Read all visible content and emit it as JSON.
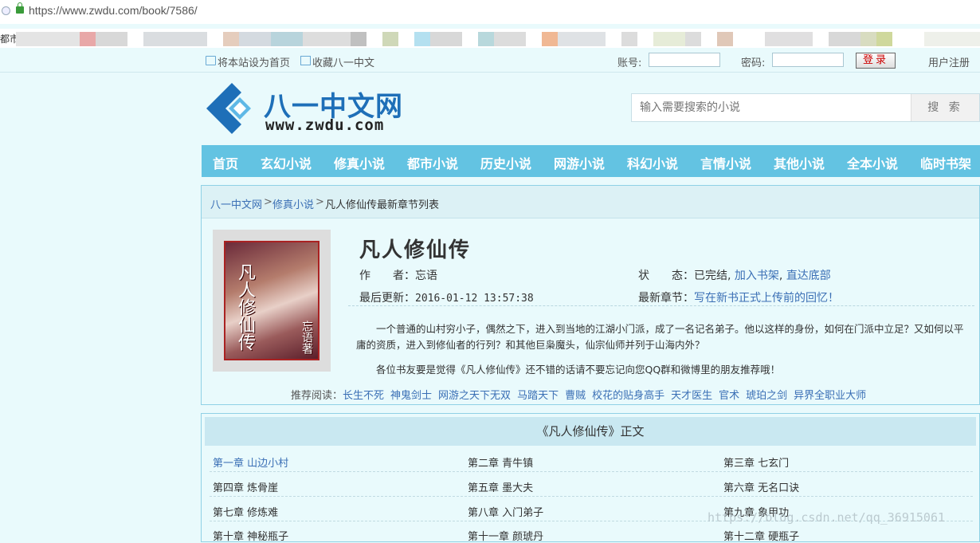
{
  "browser": {
    "url": "https://www.zwdu.com/book/7586/",
    "bookmark_label": "都市"
  },
  "topbar": {
    "set_home": "将本站设为首页",
    "favorite": "收藏八一中文",
    "account_label": "账号:",
    "password_label": "密码:",
    "login": "登录",
    "register": "用户注册"
  },
  "header": {
    "logo_cn": "八一中文网",
    "logo_url": "www.zwdu.com",
    "search_placeholder": "输入需要搜索的小说",
    "search_button": "搜 索"
  },
  "nav": [
    "首页",
    "玄幻小说",
    "修真小说",
    "都市小说",
    "历史小说",
    "网游小说",
    "科幻小说",
    "言情小说",
    "其他小说",
    "全本小说",
    "临时书架"
  ],
  "breadcrumb": {
    "home": "八一中文网",
    "category": "修真小说",
    "current": "凡人修仙传最新章节列表"
  },
  "book": {
    "title": "凡人修仙传",
    "cover_text": "凡人修仙传",
    "cover_author": "忘语著",
    "author_label": "作　　者：",
    "author": "忘语",
    "status_label": "状　　态：",
    "status": "已完结,",
    "add_shelf": "加入书架",
    "bottom": "直达底部",
    "updated_label": "最后更新：",
    "updated": "2016-01-12 13:57:38",
    "latest_label": "最新章节：",
    "latest": "写在新书正式上传前的回忆！",
    "description": "一个普通的山村穷小子，偶然之下，进入到当地的江湖小门派，成了一名记名弟子。他以这样的身份，如何在门派中立足？又如何以平庸的资质，进入到修仙者的行列？和其他巨枭魔头，仙宗仙师并列于山海内外？",
    "recommend_msg": "各位书友要是觉得《凡人修仙传》还不错的话请不要忘记向您QQ群和微博里的朋友推荐哦！"
  },
  "recommend": {
    "label": "推荐阅读：",
    "items": [
      "长生不死",
      "神鬼剑士",
      "网游之天下无双",
      "马踏天下",
      "曹贼",
      "校花的贴身高手",
      "天才医生",
      "官术",
      "琥珀之剑",
      "异界全职业大师"
    ]
  },
  "chapters": {
    "heading": "《凡人修仙传》正文",
    "items": [
      "第一章 山边小村",
      "第二章 青牛镇",
      "第三章 七玄门",
      "第四章 炼骨崖",
      "第五章 墨大夫",
      "第六章 无名口诀",
      "第七章 修炼难",
      "第八章 入门弟子",
      "第九章 象甲功",
      "第十章 神秘瓶子",
      "第十一章 颜琥丹",
      "第十二章 硬瓶子"
    ]
  },
  "watermark": "https://blog.csdn.net/qq_36915061",
  "colors": {
    "nav_bg": "#63c3e2",
    "link": "#3a6fb5",
    "page_bg": "#e9fafc"
  }
}
